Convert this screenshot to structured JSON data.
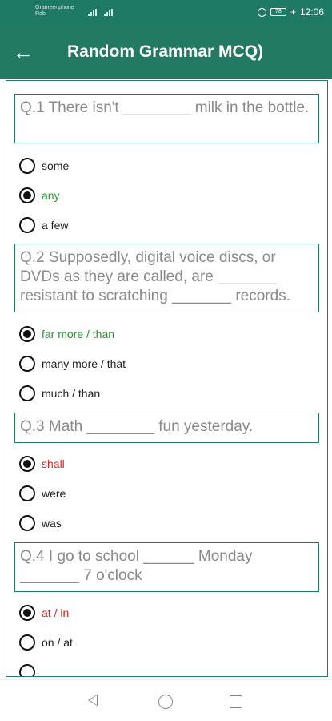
{
  "status_bar": {
    "carrier_line1": "Grameenphone",
    "carrier_line2": "Robi",
    "battery": "78",
    "time": "12:06"
  },
  "app_bar": {
    "back_icon": "arrow-left-icon",
    "title": "Random Grammar MCQ)"
  },
  "questions": [
    {
      "text": "Q.1 There isn't ________ milk in the bottle.",
      "options": [
        {
          "label": "some",
          "state": "none",
          "selected": false
        },
        {
          "label": "any",
          "state": "correct",
          "selected": true
        },
        {
          "label": "a few",
          "state": "none",
          "selected": false
        }
      ]
    },
    {
      "text": "Q.2 Supposedly, digital voice discs, or DVDs as they are called, are _______ resistant to scratching _______ records.",
      "options": [
        {
          "label": "far more / than",
          "state": "correct",
          "selected": true
        },
        {
          "label": "many more / that",
          "state": "none",
          "selected": false
        },
        {
          "label": "much / than",
          "state": "none",
          "selected": false
        }
      ]
    },
    {
      "text": "Q.3 Math ________ fun yesterday.",
      "options": [
        {
          "label": "shall",
          "state": "wrong",
          "selected": true
        },
        {
          "label": "were",
          "state": "none",
          "selected": false
        },
        {
          "label": "was",
          "state": "none",
          "selected": false
        }
      ]
    },
    {
      "text": "Q.4 I go to school ______ Monday _______ 7 o'clock",
      "options": [
        {
          "label": "at / in",
          "state": "wrong",
          "selected": true
        },
        {
          "label": "on / at",
          "state": "none",
          "selected": false
        }
      ]
    }
  ],
  "colors": {
    "primary": "#237a62",
    "correct": "#1f9a2c",
    "wrong": "#e0211d"
  }
}
